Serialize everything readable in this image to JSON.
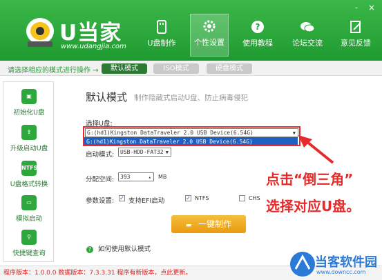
{
  "app": {
    "logo_text": "U当家",
    "logo_url": "www.udangjia.com",
    "window_controls": [
      "-",
      "×"
    ]
  },
  "nav": [
    {
      "label": "U盘制作",
      "icon": "usb-icon"
    },
    {
      "label": "个性设置",
      "icon": "gear-icon"
    },
    {
      "label": "使用教程",
      "icon": "question-icon"
    },
    {
      "label": "论坛交流",
      "icon": "chat-icon"
    },
    {
      "label": "意见反馈",
      "icon": "edit-icon"
    }
  ],
  "modebar": {
    "tip": "请选择相应的模式进行操作 →",
    "modes": [
      "默认模式",
      "ISO模式",
      "硬盘模式"
    ],
    "active": "默认模式"
  },
  "sidebar": [
    {
      "label": "初始化U盘",
      "icon": "usb-init-icon"
    },
    {
      "label": "升级启动U盘",
      "icon": "upgrade-icon"
    },
    {
      "label": "U盘格式转换",
      "icon": "ntfs-icon",
      "icon_text": "NTFS"
    },
    {
      "label": "模拟启动",
      "icon": "monitor-icon"
    },
    {
      "label": "快捷键查询",
      "icon": "search-icon"
    }
  ],
  "main": {
    "title": "默认模式",
    "subtitle": "制作隐藏式启动U盘、防止病毒侵犯",
    "select_usb_label": "选择U盘:",
    "usb_selected": "G:(hd1)Kingston DataTraveler 2.0 USB Device(6.54G)",
    "usb_options": [
      "G:(hd1)Kingston DataTraveler 2.0 USB Device(6.54G)"
    ],
    "boot_mode_label": "启动模式:",
    "boot_mode_value": "USB-HDD-FAT32",
    "alloc_label": "分配空间:",
    "alloc_value": "393",
    "alloc_unit": "MB",
    "params_label": "参数设置:",
    "param_efi": "支持EFI启动",
    "param_ntfs": "NTFS",
    "param_chs": "CHS",
    "make_button": "一键制作",
    "help_text": "如何使用默认模式"
  },
  "status": {
    "text": "程序版本：1.0.0.0   数据版本：7.3.3.31  程序有新版本，点此更新。"
  },
  "annotation": {
    "line1": "点击“倒三角”",
    "line2": "选择对应U盘。",
    "color": "#e52b2b"
  },
  "watermark": {
    "title": "当客软件园",
    "url": "www.downcc.com"
  }
}
